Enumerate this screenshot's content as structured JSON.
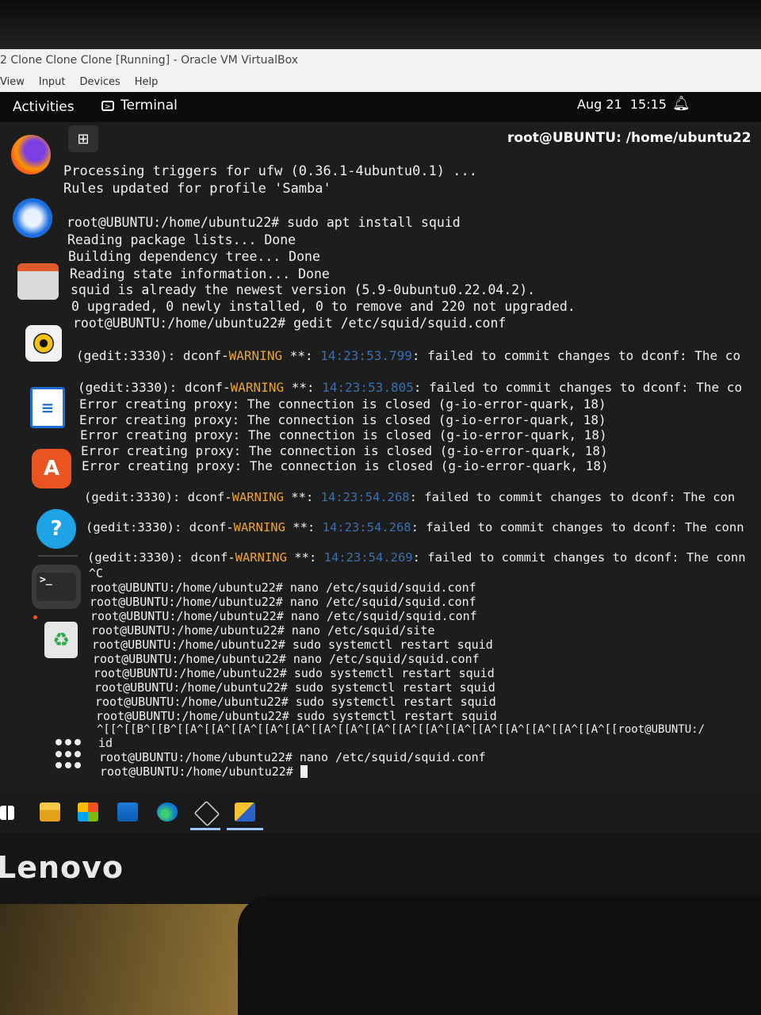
{
  "vbox": {
    "title": "2 Clone Clone Clone [Running] - Oracle VM VirtualBox",
    "menu": [
      "View",
      "Input",
      "Devices",
      "Help"
    ]
  },
  "topbar": {
    "activities": "Activities",
    "app": "Terminal",
    "date": "Aug 21",
    "time": "15:15",
    "bell_icon": "bell-icon"
  },
  "dock": {
    "items": [
      {
        "name": "Firefox",
        "icon": "firefox-icon"
      },
      {
        "name": "Thunderbird",
        "icon": "thunderbird-icon"
      },
      {
        "name": "Files",
        "icon": "files-icon"
      },
      {
        "name": "Rhythmbox",
        "icon": "rhythmbox-icon"
      },
      {
        "name": "LibreOffice Writer",
        "icon": "writer-icon"
      },
      {
        "name": "Ubuntu Software",
        "icon": "software-icon"
      },
      {
        "name": "Help",
        "icon": "help-icon"
      },
      {
        "name": "Terminal",
        "icon": "terminal-icon"
      },
      {
        "name": "Trash",
        "icon": "trash-icon"
      }
    ],
    "apps_grid_icon": "show-apps-icon"
  },
  "terminal": {
    "title": "root@UBUNTU: /home/ubuntu22",
    "new_tab_icon": "new-tab-icon",
    "lines": {
      "l1": "Processing triggers for ufw (0.36.1-4ubuntu0.1) ...",
      "l2": "Rules updated for profile 'Samba'",
      "l3": "root@UBUNTU:/home/ubuntu22# sudo apt install squid",
      "l4": "Reading package lists... Done",
      "l5": "Building dependency tree... Done",
      "l6": "Reading state information... Done",
      "l7": "squid is already the newest version (5.9-0ubuntu0.22.04.2).",
      "l8": "0 upgraded, 0 newly installed, 0 to remove and 220 not upgraded.",
      "l9": "root@UBUNTU:/home/ubuntu22# gedit /etc/squid/squid.conf",
      "w1": {
        "pre": "(gedit:3330): dconf-",
        "warn": "WARNING",
        "mid": " **: ",
        "ts": "14:23:53.799",
        "post": ": failed to commit changes to dconf: The co"
      },
      "w2": {
        "pre": "(gedit:3330): dconf-",
        "warn": "WARNING",
        "mid": " **: ",
        "ts": "14:23:53.805",
        "post": ": failed to commit changes to dconf: The co"
      },
      "e1": "Error creating proxy: The connection is closed (g-io-error-quark, 18)",
      "e2": "Error creating proxy: The connection is closed (g-io-error-quark, 18)",
      "e3": "Error creating proxy: The connection is closed (g-io-error-quark, 18)",
      "e4": "Error creating proxy: The connection is closed (g-io-error-quark, 18)",
      "e5": "Error creating proxy: The connection is closed (g-io-error-quark, 18)",
      "w3": {
        "pre": "(gedit:3330): dconf-",
        "warn": "WARNING",
        "mid": " **: ",
        "ts": "14:23:54.268",
        "post": ": failed to commit changes to dconf: The con"
      },
      "w4": {
        "pre": "(gedit:3330): dconf-",
        "warn": "WARNING",
        "mid": " **: ",
        "ts": "14:23:54.268",
        "post": ": failed to commit changes to dconf: The conn"
      },
      "w5": {
        "pre": "(gedit:3330): dconf-",
        "warn": "WARNING",
        "mid": " **: ",
        "ts": "14:23:54.269",
        "post": ": failed to commit changes to dconf: The conn"
      },
      "c0": "^C",
      "c1": "root@UBUNTU:/home/ubuntu22# nano /etc/squid/squid.conf",
      "c2": "root@UBUNTU:/home/ubuntu22# nano /etc/squid/squid.conf",
      "c3": "root@UBUNTU:/home/ubuntu22# nano /etc/squid/squid.conf",
      "c4": "root@UBUNTU:/home/ubuntu22# nano /etc/squid/site",
      "c5": "root@UBUNTU:/home/ubuntu22# sudo systemctl restart squid",
      "c6": "root@UBUNTU:/home/ubuntu22# nano /etc/squid/squid.conf",
      "c7": "root@UBUNTU:/home/ubuntu22# sudo systemctl restart squid",
      "c8": "root@UBUNTU:/home/ubuntu22# sudo systemctl restart squid",
      "c9": "root@UBUNTU:/home/ubuntu22# sudo systemctl restart squid",
      "c10": "root@UBUNTU:/home/ubuntu22# sudo systemctl restart squid",
      "c11": "^[[^[[B^[[B^[[A^[[A^[[A^[[A^[[A^[[A^[[A^[[A^[[A^[[A^[[A^[[A^[[A^[[A^[[A^[[A^[[root@UBUNTU:/",
      "c12": "id",
      "c13": "root@UBUNTU:/home/ubuntu22# nano /etc/squid/squid.conf",
      "c14": "root@UBUNTU:/home/ubuntu22# "
    }
  },
  "monitor": {
    "brand": "Lenovo"
  },
  "taskbar": {
    "items": [
      "windows-start-icon",
      "file-explorer-icon",
      "microsoft-store-icon",
      "mail-icon",
      "edge-icon",
      "virtualbox-icon",
      "virtualbox-vm-icon"
    ]
  }
}
